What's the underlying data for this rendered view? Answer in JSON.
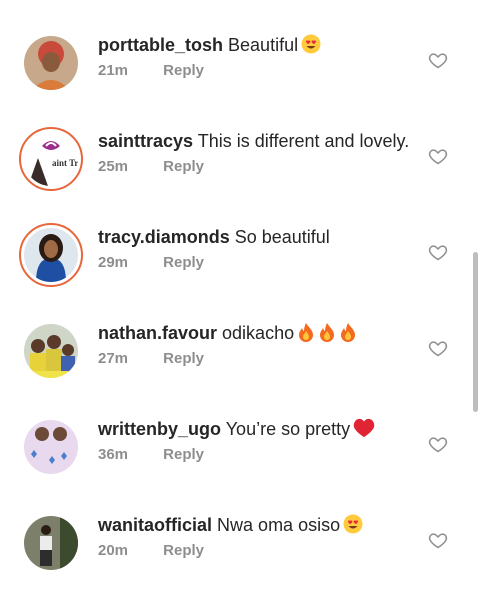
{
  "comments": [
    {
      "username": "porttable_tosh",
      "text": "Beautiful",
      "emoji": "heart-eyes-emoji",
      "time": "21m",
      "reply": "Reply"
    },
    {
      "username": "sainttracys",
      "text": "This is different and lovely.",
      "emoji": "",
      "time": "25m",
      "reply": "Reply",
      "avatar_text": "aint Tra"
    },
    {
      "username": "tracy.diamonds",
      "text": "So beautiful",
      "emoji": "",
      "time": "29m",
      "reply": "Reply"
    },
    {
      "username": "nathan.favour",
      "text": "odikacho",
      "emoji": "fire-emoji x3",
      "time": "27m",
      "reply": "Reply"
    },
    {
      "username": "writtenby_ugo",
      "text": "You’re so pretty",
      "emoji": "red-heart-emoji",
      "time": "36m",
      "reply": "Reply"
    },
    {
      "username": "wanitaofficial",
      "text": "Nwa oma osiso",
      "emoji": "heart-eyes-emoji",
      "time": "20m",
      "reply": "Reply"
    }
  ],
  "icons": {
    "like": "heart-outline-icon"
  },
  "colors": {
    "story_ring": "#e8663b",
    "meta": "#8e8e8e"
  }
}
